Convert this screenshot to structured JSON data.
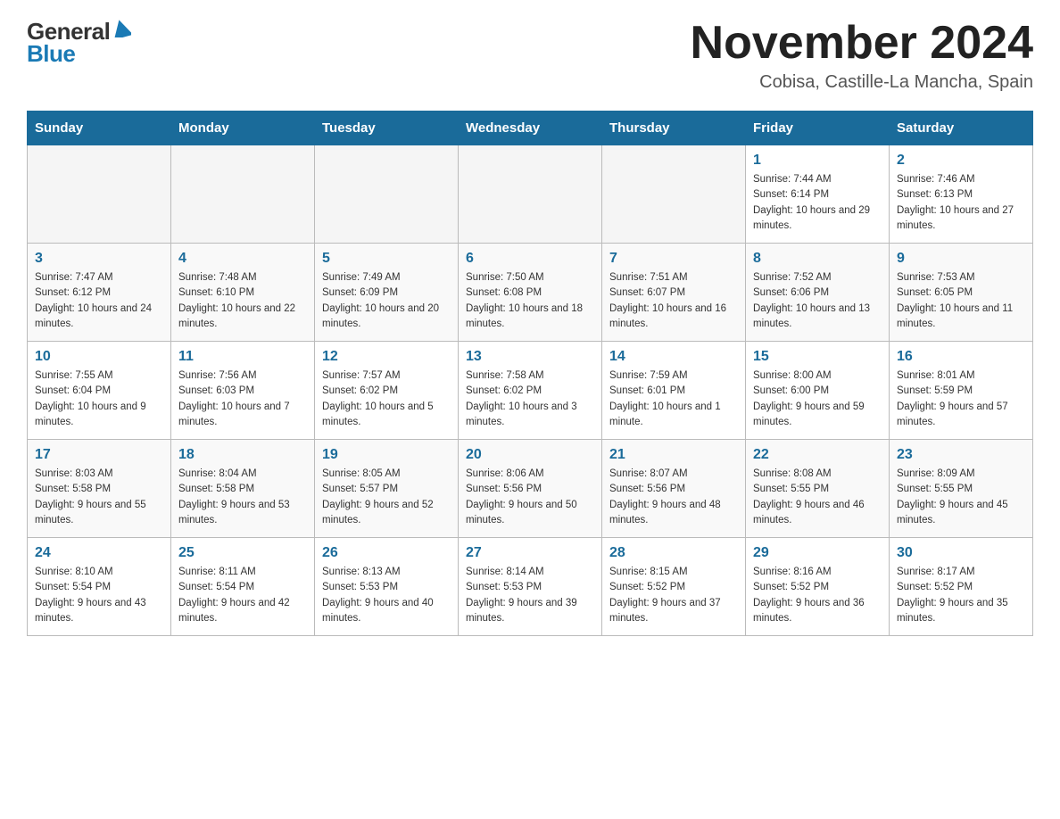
{
  "header": {
    "logo_general": "General",
    "logo_blue": "Blue",
    "month_title": "November 2024",
    "location": "Cobisa, Castille-La Mancha, Spain"
  },
  "days_of_week": [
    "Sunday",
    "Monday",
    "Tuesday",
    "Wednesday",
    "Thursday",
    "Friday",
    "Saturday"
  ],
  "weeks": [
    [
      {
        "day": "",
        "info": ""
      },
      {
        "day": "",
        "info": ""
      },
      {
        "day": "",
        "info": ""
      },
      {
        "day": "",
        "info": ""
      },
      {
        "day": "",
        "info": ""
      },
      {
        "day": "1",
        "info": "Sunrise: 7:44 AM\nSunset: 6:14 PM\nDaylight: 10 hours and 29 minutes."
      },
      {
        "day": "2",
        "info": "Sunrise: 7:46 AM\nSunset: 6:13 PM\nDaylight: 10 hours and 27 minutes."
      }
    ],
    [
      {
        "day": "3",
        "info": "Sunrise: 7:47 AM\nSunset: 6:12 PM\nDaylight: 10 hours and 24 minutes."
      },
      {
        "day": "4",
        "info": "Sunrise: 7:48 AM\nSunset: 6:10 PM\nDaylight: 10 hours and 22 minutes."
      },
      {
        "day": "5",
        "info": "Sunrise: 7:49 AM\nSunset: 6:09 PM\nDaylight: 10 hours and 20 minutes."
      },
      {
        "day": "6",
        "info": "Sunrise: 7:50 AM\nSunset: 6:08 PM\nDaylight: 10 hours and 18 minutes."
      },
      {
        "day": "7",
        "info": "Sunrise: 7:51 AM\nSunset: 6:07 PM\nDaylight: 10 hours and 16 minutes."
      },
      {
        "day": "8",
        "info": "Sunrise: 7:52 AM\nSunset: 6:06 PM\nDaylight: 10 hours and 13 minutes."
      },
      {
        "day": "9",
        "info": "Sunrise: 7:53 AM\nSunset: 6:05 PM\nDaylight: 10 hours and 11 minutes."
      }
    ],
    [
      {
        "day": "10",
        "info": "Sunrise: 7:55 AM\nSunset: 6:04 PM\nDaylight: 10 hours and 9 minutes."
      },
      {
        "day": "11",
        "info": "Sunrise: 7:56 AM\nSunset: 6:03 PM\nDaylight: 10 hours and 7 minutes."
      },
      {
        "day": "12",
        "info": "Sunrise: 7:57 AM\nSunset: 6:02 PM\nDaylight: 10 hours and 5 minutes."
      },
      {
        "day": "13",
        "info": "Sunrise: 7:58 AM\nSunset: 6:02 PM\nDaylight: 10 hours and 3 minutes."
      },
      {
        "day": "14",
        "info": "Sunrise: 7:59 AM\nSunset: 6:01 PM\nDaylight: 10 hours and 1 minute."
      },
      {
        "day": "15",
        "info": "Sunrise: 8:00 AM\nSunset: 6:00 PM\nDaylight: 9 hours and 59 minutes."
      },
      {
        "day": "16",
        "info": "Sunrise: 8:01 AM\nSunset: 5:59 PM\nDaylight: 9 hours and 57 minutes."
      }
    ],
    [
      {
        "day": "17",
        "info": "Sunrise: 8:03 AM\nSunset: 5:58 PM\nDaylight: 9 hours and 55 minutes."
      },
      {
        "day": "18",
        "info": "Sunrise: 8:04 AM\nSunset: 5:58 PM\nDaylight: 9 hours and 53 minutes."
      },
      {
        "day": "19",
        "info": "Sunrise: 8:05 AM\nSunset: 5:57 PM\nDaylight: 9 hours and 52 minutes."
      },
      {
        "day": "20",
        "info": "Sunrise: 8:06 AM\nSunset: 5:56 PM\nDaylight: 9 hours and 50 minutes."
      },
      {
        "day": "21",
        "info": "Sunrise: 8:07 AM\nSunset: 5:56 PM\nDaylight: 9 hours and 48 minutes."
      },
      {
        "day": "22",
        "info": "Sunrise: 8:08 AM\nSunset: 5:55 PM\nDaylight: 9 hours and 46 minutes."
      },
      {
        "day": "23",
        "info": "Sunrise: 8:09 AM\nSunset: 5:55 PM\nDaylight: 9 hours and 45 minutes."
      }
    ],
    [
      {
        "day": "24",
        "info": "Sunrise: 8:10 AM\nSunset: 5:54 PM\nDaylight: 9 hours and 43 minutes."
      },
      {
        "day": "25",
        "info": "Sunrise: 8:11 AM\nSunset: 5:54 PM\nDaylight: 9 hours and 42 minutes."
      },
      {
        "day": "26",
        "info": "Sunrise: 8:13 AM\nSunset: 5:53 PM\nDaylight: 9 hours and 40 minutes."
      },
      {
        "day": "27",
        "info": "Sunrise: 8:14 AM\nSunset: 5:53 PM\nDaylight: 9 hours and 39 minutes."
      },
      {
        "day": "28",
        "info": "Sunrise: 8:15 AM\nSunset: 5:52 PM\nDaylight: 9 hours and 37 minutes."
      },
      {
        "day": "29",
        "info": "Sunrise: 8:16 AM\nSunset: 5:52 PM\nDaylight: 9 hours and 36 minutes."
      },
      {
        "day": "30",
        "info": "Sunrise: 8:17 AM\nSunset: 5:52 PM\nDaylight: 9 hours and 35 minutes."
      }
    ]
  ]
}
